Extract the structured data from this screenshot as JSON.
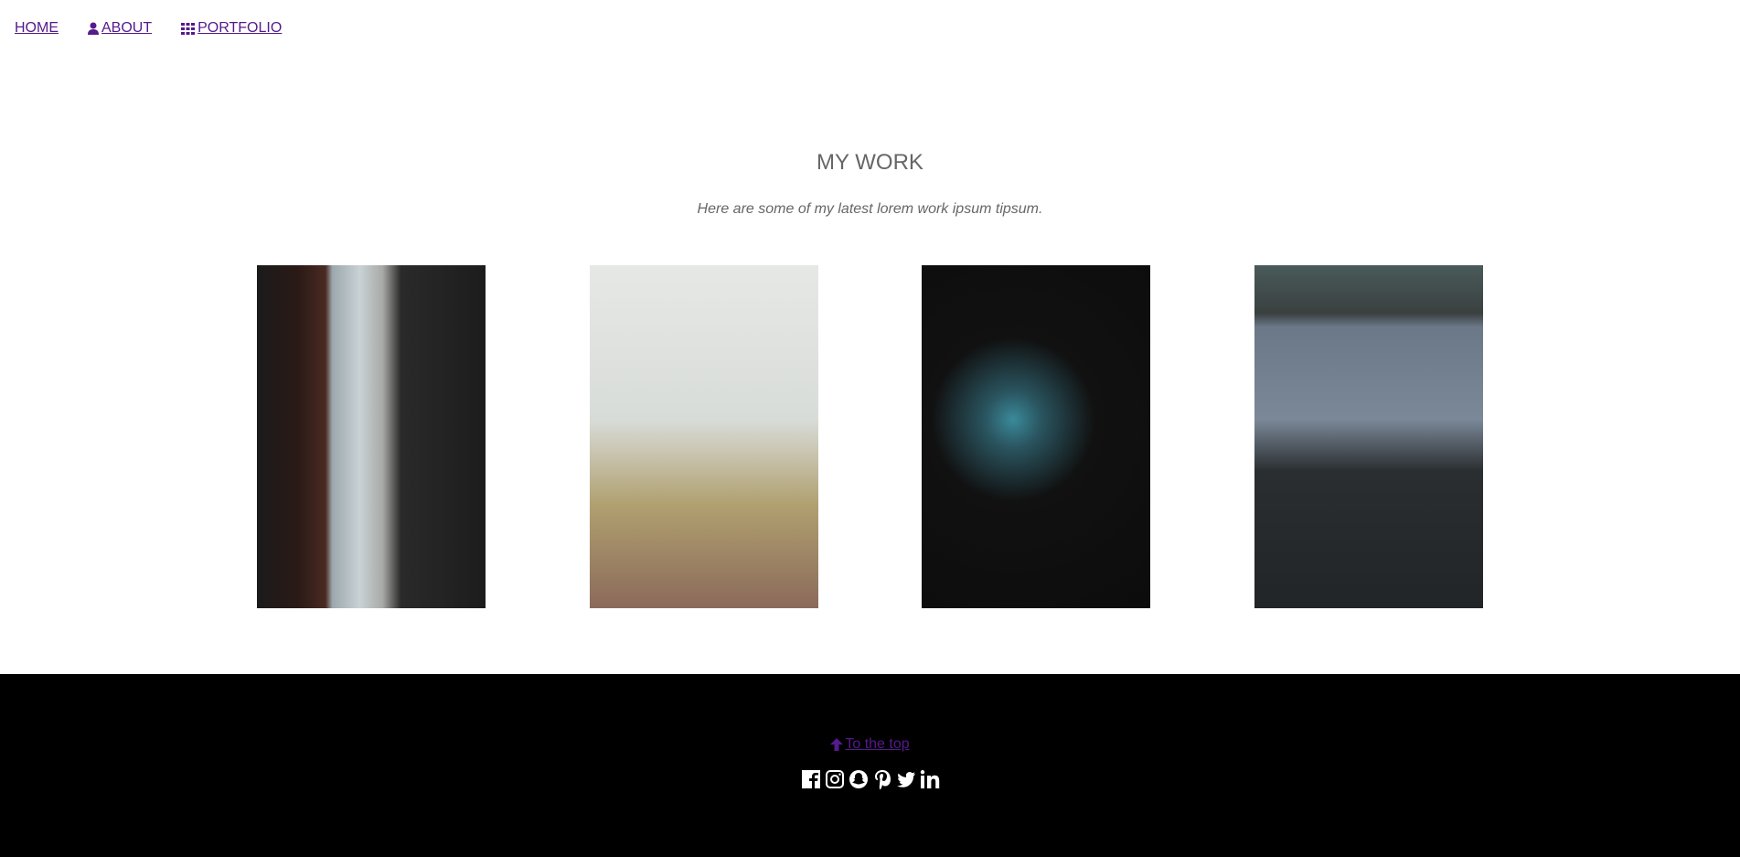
{
  "nav": {
    "items": [
      {
        "label": "HOME",
        "icon": ""
      },
      {
        "label": " ABOUT",
        "icon": "user-icon"
      },
      {
        "label": " PORTFOLIO",
        "icon": "grid-icon"
      }
    ]
  },
  "main": {
    "title": "MY WORK",
    "subtitle": "Here are some of my latest lorem work ipsum tipsum.",
    "gallery": [
      "cathedral-alley-photo",
      "foggy-path-fence-photo",
      "bee-eater-bird-photo",
      "bridge-traffic-photo"
    ]
  },
  "footer": {
    "to_top": "To the top",
    "social": [
      "facebook-icon",
      "instagram-icon",
      "snapchat-icon",
      "pinterest-icon",
      "twitter-icon",
      "linkedin-icon"
    ]
  },
  "colors": {
    "link": "#551a8b",
    "heading": "#666666",
    "footer_bg": "#000000"
  }
}
